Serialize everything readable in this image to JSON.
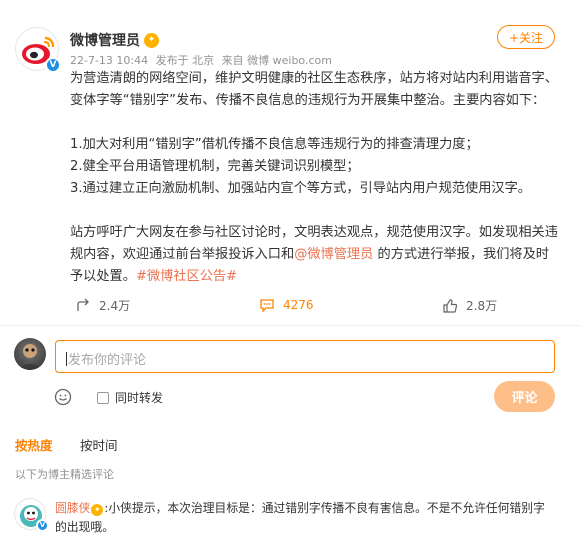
{
  "post": {
    "author": "微博管理员",
    "date": "22-7-13 10:44",
    "location": "发布于 北京",
    "source": "来自 微博 weibo.com",
    "follow_label": "+关注",
    "paragraph1": "为营造清朗的网络空间，维护文明健康的社区生态秩序，站方将对站内利用谐音字、变体字等“错别字”发布、传播不良信息的违规行为开展集中整治。主要内容如下：",
    "item1": "1.加大对利用“错别字”借机传播不良信息等违规行为的排查清理力度；",
    "item2": "2.健全平台用语管理机制，完善关键词识别模型；",
    "item3": "3.通过建立正向激励机制、加强站内宣个等方式，引导站内用户规范使用汉字。",
    "paragraph3_start": "站方呼吁广大网友在参与社区讨论时，文明表达观点，规范使用汉字。如发现相关违规内容，欢迎通过前台举报投诉入口和",
    "mention": "@微博管理员",
    "paragraph3_end": " 的方式进行举报，我们将及时予以处置。",
    "hashtag": "#微博社区公告#"
  },
  "actions": {
    "repost_count": "2.4万",
    "comment_count": "4276",
    "like_count": "2.8万"
  },
  "composer": {
    "placeholder": "发布你的评论",
    "repost_label": "同时转发",
    "submit_label": "评论"
  },
  "sort": {
    "hot_label": "按热度",
    "time_label": "按时间"
  },
  "hint": "以下为博主精选评论",
  "comment": {
    "name": "圆膝侠",
    "text": ":小侠提示，本次治理目标是：通过错别字传播不良有害信息。不是不允许任何错别字的出现哦。"
  },
  "colors": {
    "accent": "#ff8200",
    "link": "#eb7350",
    "verified": "#1e8fe1"
  }
}
